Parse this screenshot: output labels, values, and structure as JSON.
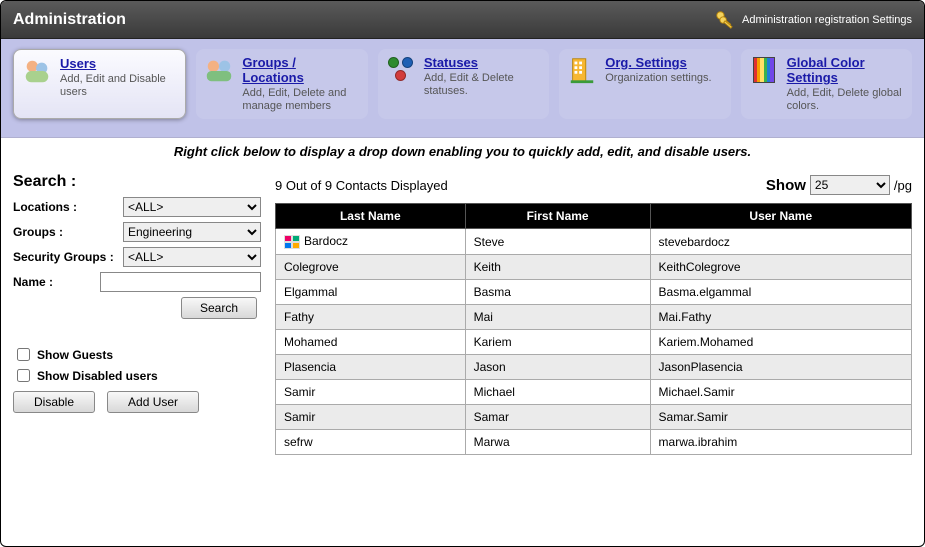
{
  "header": {
    "title": "Administration",
    "settings_link": "Administration registration Settings"
  },
  "nav": [
    {
      "title": "Users",
      "sub": "Add, Edit and Disable users",
      "active": true
    },
    {
      "title": "Groups / Locations",
      "sub": "Add, Edit, Delete and manage members",
      "active": false
    },
    {
      "title": "Statuses",
      "sub": "Add, Edit & Delete statuses.",
      "active": false
    },
    {
      "title": "Org. Settings",
      "sub": "Organization settings.",
      "active": false
    },
    {
      "title": "Global Color Settings",
      "sub": "Add, Edit, Delete global colors.",
      "active": false
    }
  ],
  "instruction": "Right click below to display a drop down enabling you to quickly add, edit, and disable users.",
  "search": {
    "heading": "Search :",
    "labels": {
      "locations": "Locations :",
      "groups": "Groups :",
      "security": "Security Groups :",
      "name": "Name :"
    },
    "values": {
      "locations": "<ALL>",
      "groups": "Engineering",
      "security": "<ALL>",
      "name": ""
    },
    "search_btn": "Search",
    "show_guests": "Show Guests",
    "show_disabled": "Show Disabled users",
    "disable_btn": "Disable",
    "add_user_btn": "Add User"
  },
  "list": {
    "count_text": "9 Out of 9 Contacts Displayed",
    "show_label": "Show",
    "per_page": "25",
    "per_page_suffix": "/pg",
    "columns": {
      "last": "Last Name",
      "first": "First Name",
      "user": "User Name"
    },
    "rows": [
      {
        "last": "Bardocz",
        "first": "Steve",
        "user": "stevebardocz",
        "icon": true
      },
      {
        "last": "Colegrove",
        "first": "Keith",
        "user": "KeithColegrove",
        "icon": false
      },
      {
        "last": "Elgammal",
        "first": "Basma",
        "user": "Basma.elgammal",
        "icon": false
      },
      {
        "last": "Fathy",
        "first": "Mai",
        "user": "Mai.Fathy",
        "icon": false
      },
      {
        "last": "Mohamed",
        "first": "Kariem",
        "user": "Kariem.Mohamed",
        "icon": false
      },
      {
        "last": "Plasencia",
        "first": "Jason",
        "user": "JasonPlasencia",
        "icon": false
      },
      {
        "last": "Samir",
        "first": "Michael",
        "user": "Michael.Samir",
        "icon": false
      },
      {
        "last": "Samir",
        "first": "Samar",
        "user": "Samar.Samir",
        "icon": false
      },
      {
        "last": "sefrw",
        "first": "Marwa",
        "user": "marwa.ibrahim",
        "icon": false
      }
    ]
  }
}
